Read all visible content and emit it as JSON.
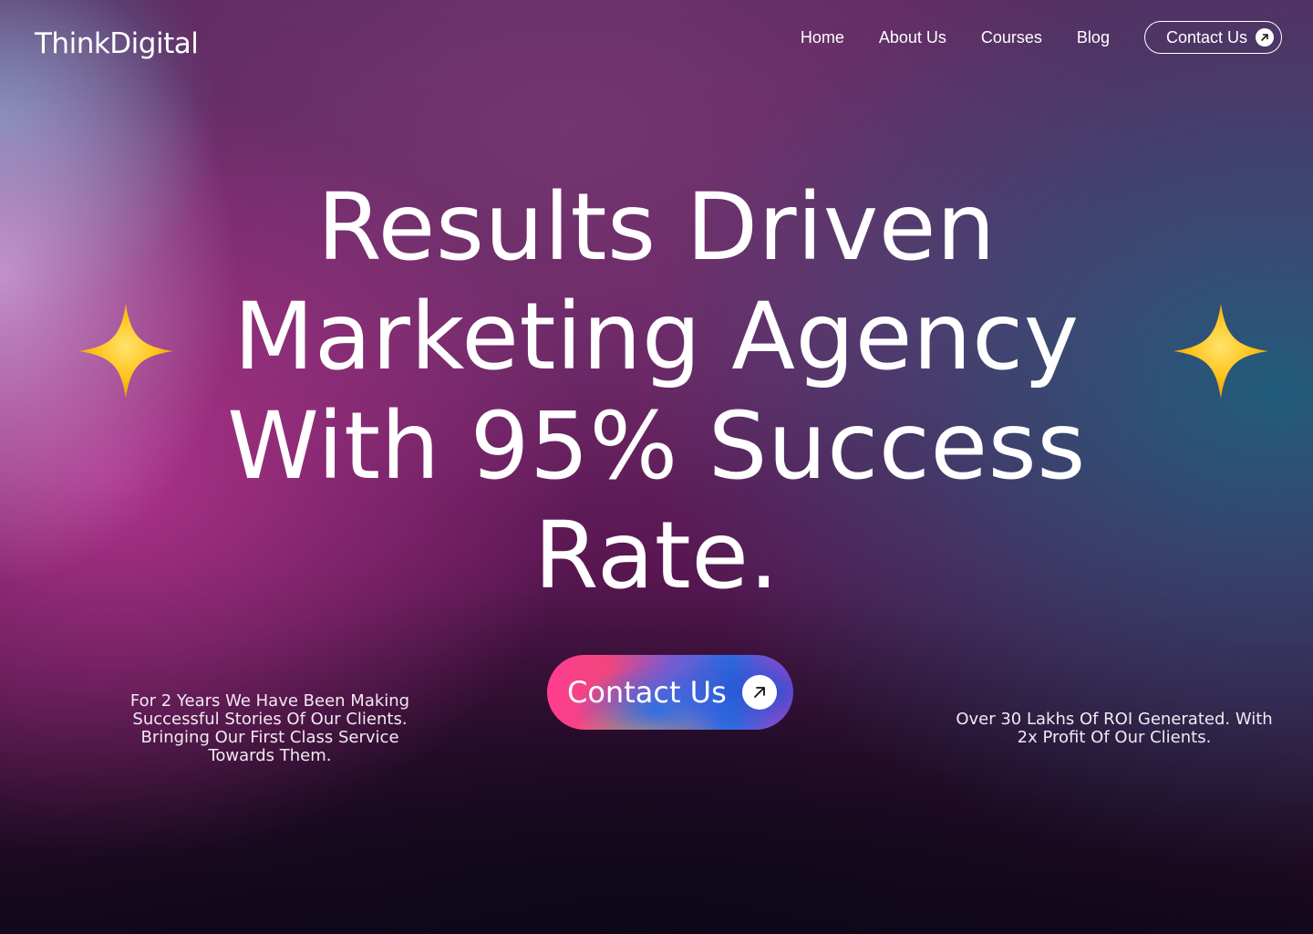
{
  "header": {
    "logo": "ThinkDigital",
    "nav": {
      "items": [
        "Home",
        "About Us",
        "Courses",
        "Blog"
      ],
      "contact_label": "Contact Us"
    }
  },
  "hero": {
    "heading_lines": [
      "Results Driven",
      "Marketing Agency",
      "With 95% Success",
      "Rate."
    ],
    "cta_label": "Contact Us",
    "left_text": "For 2 Years We Have Been Making Successful Stories Of Our Clients. Bringing Our First Class Service Towards Them.",
    "right_text": "Over 30 Lakhs Of ROI Generated. With 2x Profit Of Our Clients."
  },
  "icons": {
    "nav_contact": "arrow-up-right-icon",
    "cta": "arrow-up-right-icon",
    "decor": "sparkle-icon"
  },
  "colors": {
    "sparkle": "#ffc21a",
    "text": "#ffffff"
  }
}
